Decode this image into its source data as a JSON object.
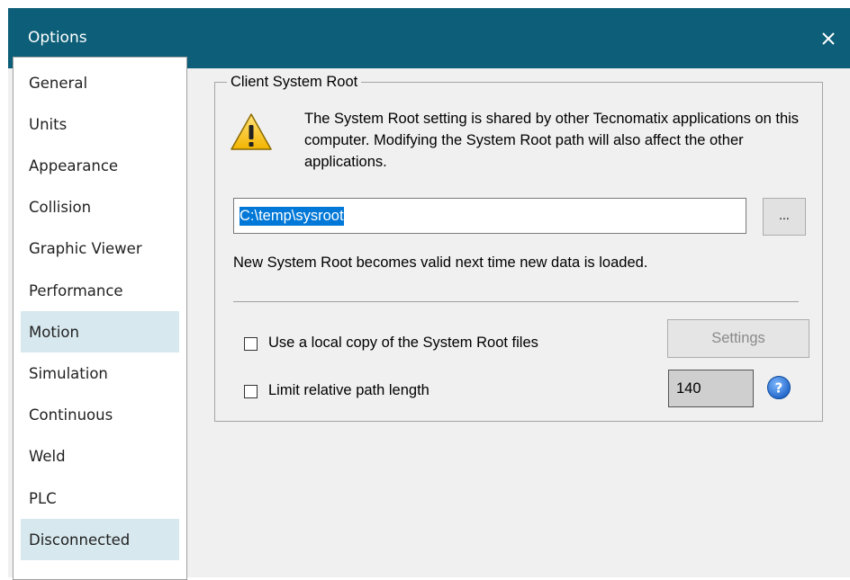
{
  "window": {
    "title": "Options",
    "close_glyph": "✕"
  },
  "nav": {
    "items": [
      {
        "label": "General",
        "shaded": false
      },
      {
        "label": "Units",
        "shaded": false
      },
      {
        "label": "Appearance",
        "shaded": false
      },
      {
        "label": "Collision",
        "shaded": false
      },
      {
        "label": "Graphic Viewer",
        "shaded": false
      },
      {
        "label": "Performance",
        "shaded": false
      },
      {
        "label": "Motion",
        "shaded": true
      },
      {
        "label": "Simulation",
        "shaded": false
      },
      {
        "label": "Continuous",
        "shaded": false
      },
      {
        "label": "Weld",
        "shaded": false
      },
      {
        "label": "PLC",
        "shaded": false
      },
      {
        "label": "Disconnected",
        "shaded": true
      }
    ]
  },
  "group": {
    "title": "Client System Root",
    "warning_icon": "warning-icon",
    "info_text": "The System Root setting is shared by other Tecnomatix applications on this computer. Modifying the System Root path will also affect the other applications.",
    "path_value": "C:\\temp\\sysroot",
    "browse_label": "...",
    "valid_text": "New System Root becomes valid next time new data is loaded.",
    "local_copy": {
      "label": "Use a local copy of the System Root files",
      "checked": false
    },
    "settings_label": "Settings",
    "limit_path": {
      "label": "Limit relative path length",
      "checked": false
    },
    "path_length_value": "140",
    "help_icon": "help-icon"
  },
  "colors": {
    "titlebar": "#0d5e78",
    "nav_shaded": "#d7e8ee",
    "selection": "#0078d7",
    "help_blue": "#1a6fd0"
  }
}
